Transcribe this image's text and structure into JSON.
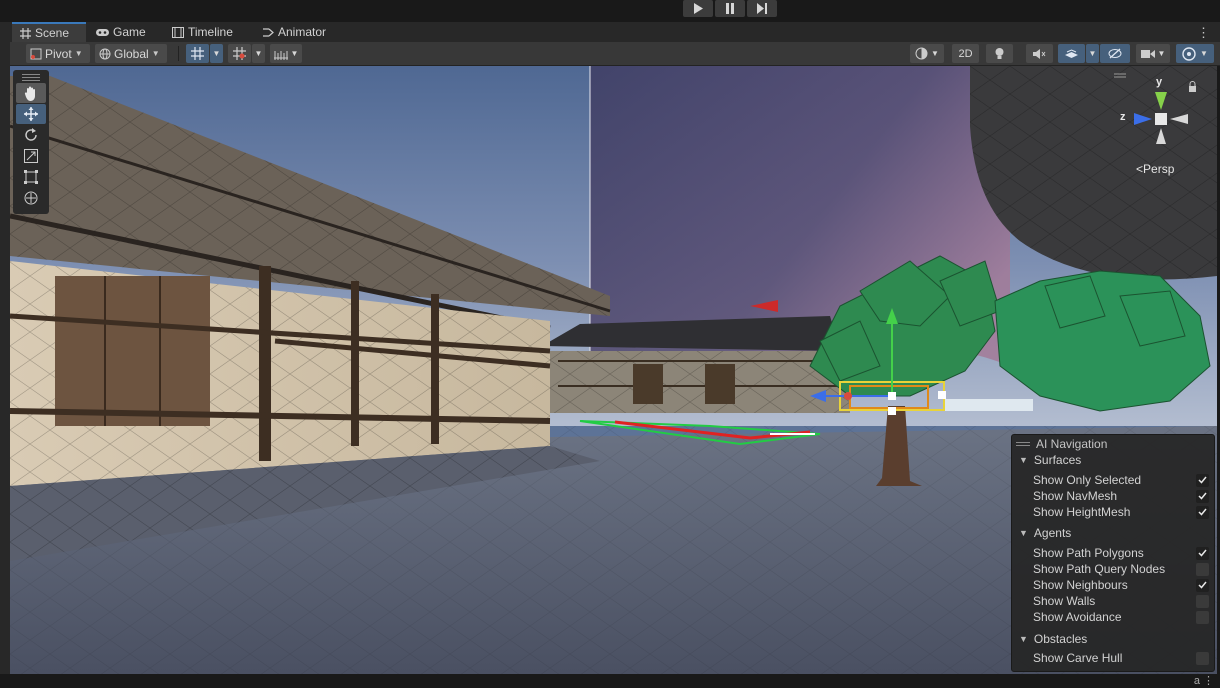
{
  "playbar": {
    "play_icon": "play-icon",
    "pause_icon": "pause-icon",
    "step_icon": "step-icon"
  },
  "tabs": [
    {
      "label": "Scene",
      "icon": "hash-grid-icon",
      "active": true
    },
    {
      "label": "Game",
      "icon": "gamepad-icon",
      "active": false
    },
    {
      "label": "Timeline",
      "icon": "film-icon",
      "active": false
    },
    {
      "label": "Animator",
      "icon": "animator-icon",
      "active": false
    }
  ],
  "tab_more": "⋮",
  "toolbar": {
    "pivot": "Pivot",
    "global": "Global",
    "btn_2d": "2D"
  },
  "tools": [
    "hand-tool",
    "move-tool",
    "rotate-tool",
    "scale-tool",
    "rect-tool",
    "transform-tool"
  ],
  "gizmo": {
    "y": "y",
    "z": "z",
    "persp": "Persp"
  },
  "ai_nav": {
    "title": "AI Navigation",
    "surfaces": {
      "label": "Surfaces",
      "options": [
        {
          "label": "Show Only Selected",
          "checked": true
        },
        {
          "label": "Show NavMesh",
          "checked": true
        },
        {
          "label": "Show HeightMesh",
          "checked": true
        }
      ]
    },
    "agents": {
      "label": "Agents",
      "options": [
        {
          "label": "Show Path Polygons",
          "checked": true
        },
        {
          "label": "Show Path Query Nodes",
          "checked": false
        },
        {
          "label": "Show Neighbours",
          "checked": true
        },
        {
          "label": "Show Walls",
          "checked": false
        },
        {
          "label": "Show Avoidance",
          "checked": false
        }
      ]
    },
    "obstacles": {
      "label": "Obstacles",
      "options": [
        {
          "label": "Show Carve Hull",
          "checked": false
        }
      ]
    }
  },
  "status": {
    "icons": "a ⋮"
  },
  "colors": {
    "accent": "#3a79bb",
    "active_tool": "#46607c",
    "sky": "#5d7397",
    "ground": "#5b6373",
    "tree": "#2e8a50"
  }
}
